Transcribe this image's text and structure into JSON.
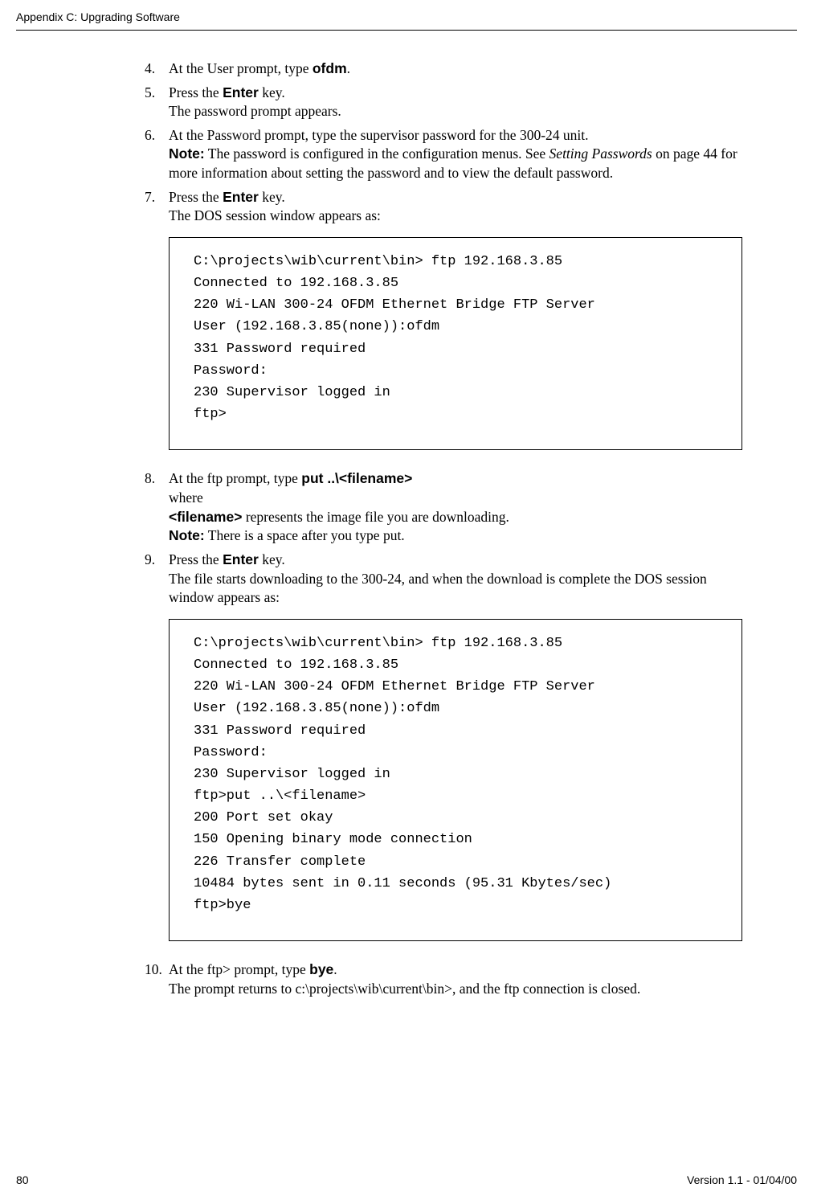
{
  "header": {
    "title": "Appendix C: Upgrading Software"
  },
  "steps": {
    "s4": {
      "num": "4.",
      "text_a": "At the User prompt, type ",
      "cmd": "ofdm",
      "text_b": "."
    },
    "s5": {
      "num": "5.",
      "text_a": "Press the ",
      "cmd": "Enter",
      "text_b": " key.",
      "line2": "The password prompt appears."
    },
    "s6": {
      "num": "6.",
      "line1": "At the Password prompt, type the supervisor password for the 300-24 unit.",
      "note_label": "Note:",
      "note_a": " The password is configured in the configuration menus. See ",
      "note_italic": "Setting Passwords",
      "note_b": " on page 44 for more information about setting the password and to view the default password."
    },
    "s7": {
      "num": "7.",
      "text_a": "Press the ",
      "cmd": "Enter",
      "text_b": " key.",
      "line2": "The DOS session window appears as:"
    },
    "s8": {
      "num": "8.",
      "text_a": "At the ftp prompt, type ",
      "cmd": "put  ..\\<filename>",
      "line2": "where",
      "fn_label": "<filename>",
      "fn_text": " represents the image file you are downloading.",
      "note_label": "Note:",
      "note_text": " There is a space after you type put."
    },
    "s9": {
      "num": "9.",
      "text_a": "Press the ",
      "cmd": "Enter",
      "text_b": " key.",
      "line2": "The file starts downloading to the 300-24, and when the download is complete the DOS session window appears as:"
    },
    "s10": {
      "num": "10.",
      "text_a": "At the ftp> prompt, type ",
      "cmd": "bye",
      "text_b": ".",
      "line2": "The prompt returns to c:\\projects\\wib\\current\\bin>, and the ftp connection is closed."
    }
  },
  "code1": "C:\\projects\\wib\\current\\bin> ftp 192.168.3.85\nConnected to 192.168.3.85\n220 Wi-LAN 300-24 OFDM Ethernet Bridge FTP Server\nUser (192.168.3.85(none)):ofdm\n331 Password required\nPassword:\n230 Supervisor logged in\nftp>",
  "code2": "C:\\projects\\wib\\current\\bin> ftp 192.168.3.85\nConnected to 192.168.3.85\n220 Wi-LAN 300-24 OFDM Ethernet Bridge FTP Server\nUser (192.168.3.85(none)):ofdm\n331 Password required\nPassword:\n230 Supervisor logged in\nftp>put ..\\<filename>\n200 Port set okay\n150 Opening binary mode connection\n226 Transfer complete\n10484 bytes sent in 0.11 seconds (95.31 Kbytes/sec)\nftp>bye",
  "footer": {
    "page": "80",
    "version": "Version 1.1 - 01/04/00"
  }
}
